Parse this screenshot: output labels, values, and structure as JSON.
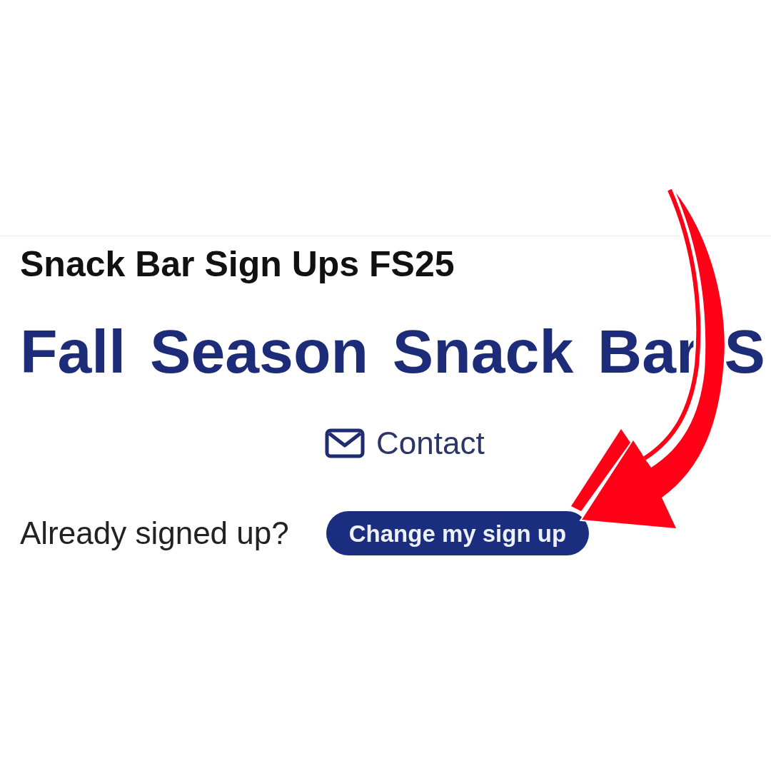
{
  "page_title": "Snack Bar Sign Ups FS25",
  "heading": "Fall Season Snack Bar S",
  "contact_link": {
    "label": "Contact"
  },
  "sign_up_prompt": {
    "text": "Already signed up?",
    "button": "Change my sign up"
  }
}
